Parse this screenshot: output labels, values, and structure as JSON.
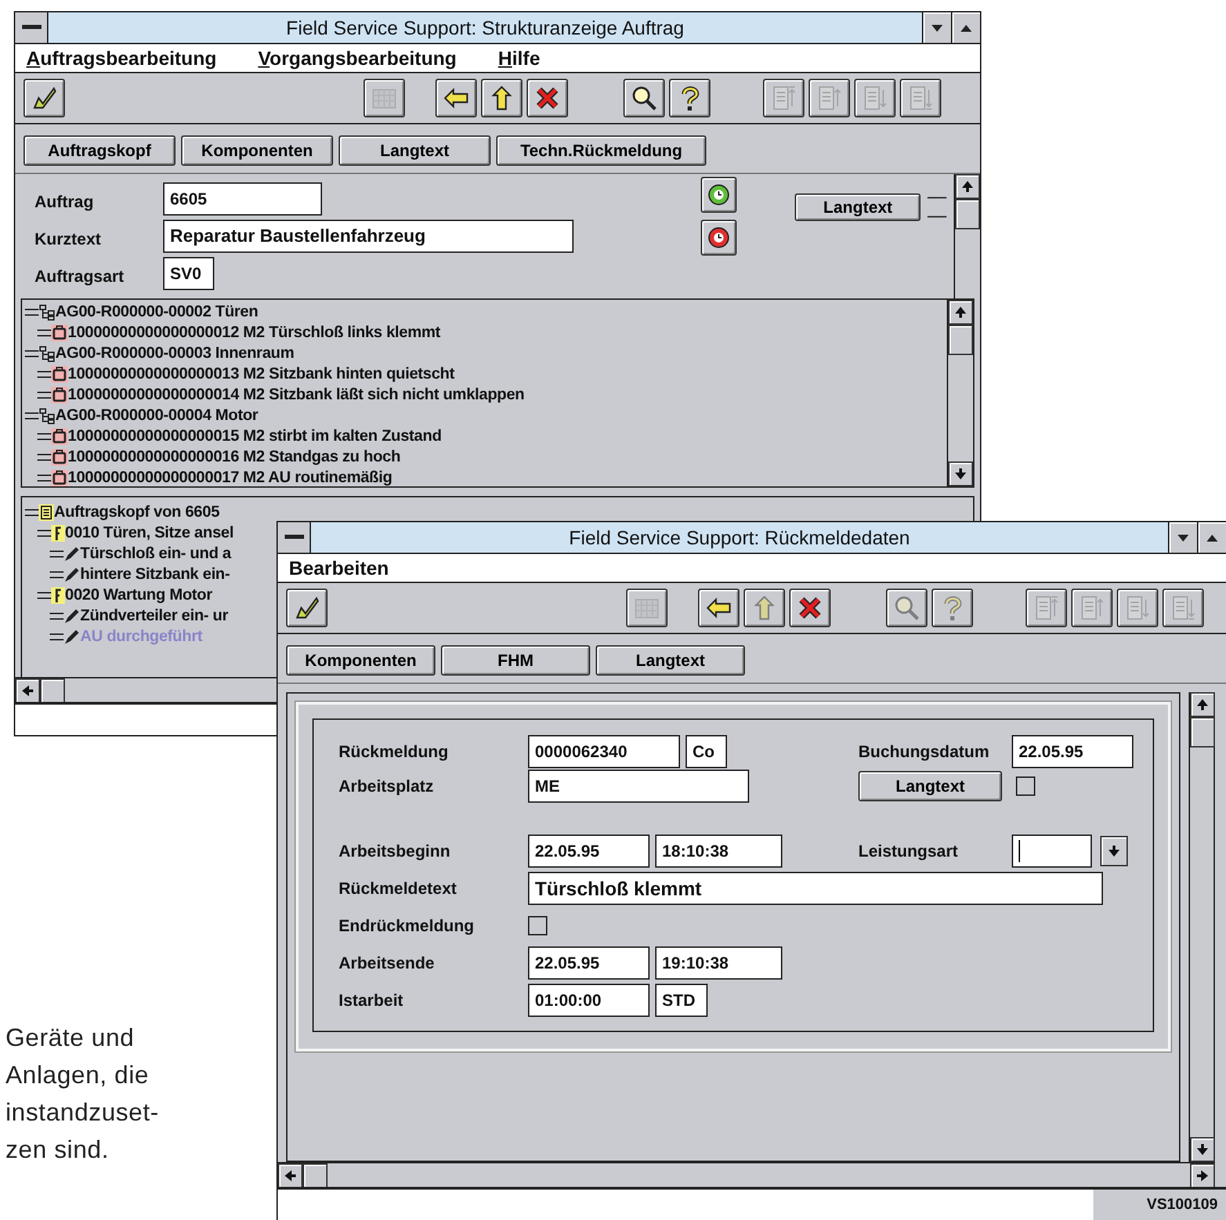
{
  "order_window": {
    "title": "Field Service Support: Strukturanzeige Auftrag",
    "menu": [
      {
        "label": "Auftragsbearbeitung",
        "mnemonic_underlined": true
      },
      {
        "label": "Vorgangsbearbeitung",
        "mnemonic_underlined": true
      },
      {
        "label": "Hilfe",
        "mnemonic_underlined": true
      }
    ],
    "toolbar": [
      [
        {
          "kind": "check",
          "disabled": false
        }
      ],
      [
        {
          "kind": "calendar",
          "disabled": true
        }
      ],
      [
        {
          "kind": "back",
          "disabled": false
        },
        {
          "kind": "up",
          "disabled": false
        },
        {
          "kind": "cancel",
          "disabled": false
        }
      ],
      [
        {
          "kind": "find",
          "disabled": false
        },
        {
          "kind": "help",
          "disabled": false
        }
      ],
      [
        {
          "kind": "first",
          "disabled": true
        },
        {
          "kind": "prev",
          "disabled": true
        },
        {
          "kind": "next",
          "disabled": true
        },
        {
          "kind": "last",
          "disabled": true
        }
      ]
    ],
    "tabs": [
      "Auftragskopf",
      "Komponenten",
      "Langtext",
      "Techn.Rückmeldung"
    ],
    "fields": [
      {
        "label": "Auftrag",
        "value": "6605",
        "kind": "order"
      },
      {
        "label": "Kurztext",
        "value": "Reparatur Baustellenfahrzeug",
        "kind": "longtext"
      },
      {
        "label": "Auftragsart",
        "value": "SV0",
        "kind": "short"
      }
    ],
    "clock_buttons": [
      {
        "kind": "start"
      },
      {
        "kind": "stop"
      }
    ],
    "longtext_button": "Langtext",
    "structure_tree": [
      {
        "kind": "operation",
        "text": "AG00-R000000-00002 Türen",
        "children": [
          {
            "kind": "notification",
            "text": "10000000000000000012 M2 Türschloß links klemmt"
          }
        ]
      },
      {
        "kind": "operation",
        "text": "AG00-R000000-00003 Innenraum",
        "children": [
          {
            "kind": "notification",
            "text": "10000000000000000013 M2 Sitzbank hinten quietscht"
          },
          {
            "kind": "notification",
            "text": "10000000000000000014 M2 Sitzbank läßt sich nicht umklappen"
          }
        ]
      },
      {
        "kind": "operation",
        "text": "AG00-R000000-00004 Motor",
        "children": [
          {
            "kind": "notification",
            "text": "10000000000000000015 M2 stirbt im kalten Zustand"
          },
          {
            "kind": "notification",
            "text": "10000000000000000016 M2 Standgas zu hoch"
          },
          {
            "kind": "notification",
            "text": "10000000000000000017 M2 AU routinemäßig"
          }
        ]
      }
    ],
    "header_tree": [
      {
        "kind": "header",
        "text": "Auftragskopf von 6605",
        "dimmed": false,
        "children": [
          {
            "kind": "phase",
            "text": "0010 Türen, Sitze ansel",
            "dimmed": false,
            "children": [
              {
                "kind": "task",
                "text": "Türschloß ein- und a",
                "dimmed": false
              },
              {
                "kind": "task",
                "text": "hintere Sitzbank ein-",
                "dimmed": false
              }
            ]
          },
          {
            "kind": "phase",
            "text": "0020 Wartung Motor",
            "dimmed": false,
            "children": [
              {
                "kind": "task",
                "text": "Zündverteiler ein- ur",
                "dimmed": false
              },
              {
                "kind": "task",
                "text": "AU durchgeführt",
                "dimmed": true
              }
            ]
          }
        ]
      }
    ]
  },
  "confirmation_window": {
    "title": "Field Service Support: Rückmeldedaten",
    "menu": [
      {
        "label": "Bearbeiten",
        "mnemonic_underlined": false
      }
    ],
    "toolbar": [
      [
        {
          "kind": "check",
          "disabled": false
        }
      ],
      [
        {
          "kind": "calendar",
          "disabled": true
        }
      ],
      [
        {
          "kind": "back",
          "disabled": false
        },
        {
          "kind": "up",
          "disabled": true
        },
        {
          "kind": "cancel",
          "disabled": false
        }
      ],
      [
        {
          "kind": "find",
          "disabled": true
        },
        {
          "kind": "help",
          "disabled": true
        }
      ],
      [
        {
          "kind": "first",
          "disabled": true
        },
        {
          "kind": "prev",
          "disabled": true
        },
        {
          "kind": "next",
          "disabled": true
        },
        {
          "kind": "last",
          "disabled": true
        }
      ]
    ],
    "tabs": [
      "Komponenten",
      "FHM",
      "Langtext"
    ],
    "rows": [
      {
        "left": [
          {
            "kind": "label",
            "text": "Rückmeldung"
          },
          {
            "kind": "number",
            "value": "0000062340"
          },
          {
            "kind": "short",
            "value": "Co"
          }
        ],
        "right": [
          {
            "kind": "label",
            "text": "Buchungsdatum"
          },
          {
            "kind": "date",
            "value": "22.05.95"
          }
        ]
      },
      {
        "left": [
          {
            "kind": "label",
            "text": "Arbeitsplatz"
          },
          {
            "kind": "text",
            "value": "ME"
          }
        ],
        "right": [
          {
            "kind": "button",
            "text": "Langtext"
          },
          {
            "kind": "checkbox",
            "checked": false
          }
        ]
      },
      {
        "left": [
          {
            "kind": "label",
            "text": "Arbeitsbeginn"
          },
          {
            "kind": "date",
            "value": "22.05.95"
          },
          {
            "kind": "time",
            "value": "18:10:38"
          }
        ],
        "right": [
          {
            "kind": "label",
            "text": "Leistungsart"
          },
          {
            "kind": "code",
            "focused": true
          },
          {
            "kind": "dropdown"
          }
        ]
      },
      {
        "left": [
          {
            "kind": "label",
            "text": "Rückmeldetext"
          },
          {
            "kind": "longtext",
            "value": "Türschloß klemmt"
          }
        ],
        "right": []
      },
      {
        "left": [
          {
            "kind": "label",
            "text": "Endrückmeldung"
          },
          {
            "kind": "checkbox",
            "checked": false
          }
        ],
        "right": []
      },
      {
        "left": [
          {
            "kind": "label",
            "text": "Arbeitsende"
          },
          {
            "kind": "date",
            "value": "22.05.95"
          },
          {
            "kind": "time",
            "value": "19:10:38"
          }
        ],
        "right": []
      },
      {
        "left": [
          {
            "kind": "label",
            "text": "Istarbeit"
          },
          {
            "kind": "date",
            "value": "01:00:00"
          },
          {
            "kind": "unit",
            "value": "STD"
          }
        ],
        "right": []
      }
    ],
    "status_code": "VS100109"
  },
  "caption": [
    "Geräte und",
    "Anlagen, die",
    "instandzuset-",
    "zen sind."
  ]
}
